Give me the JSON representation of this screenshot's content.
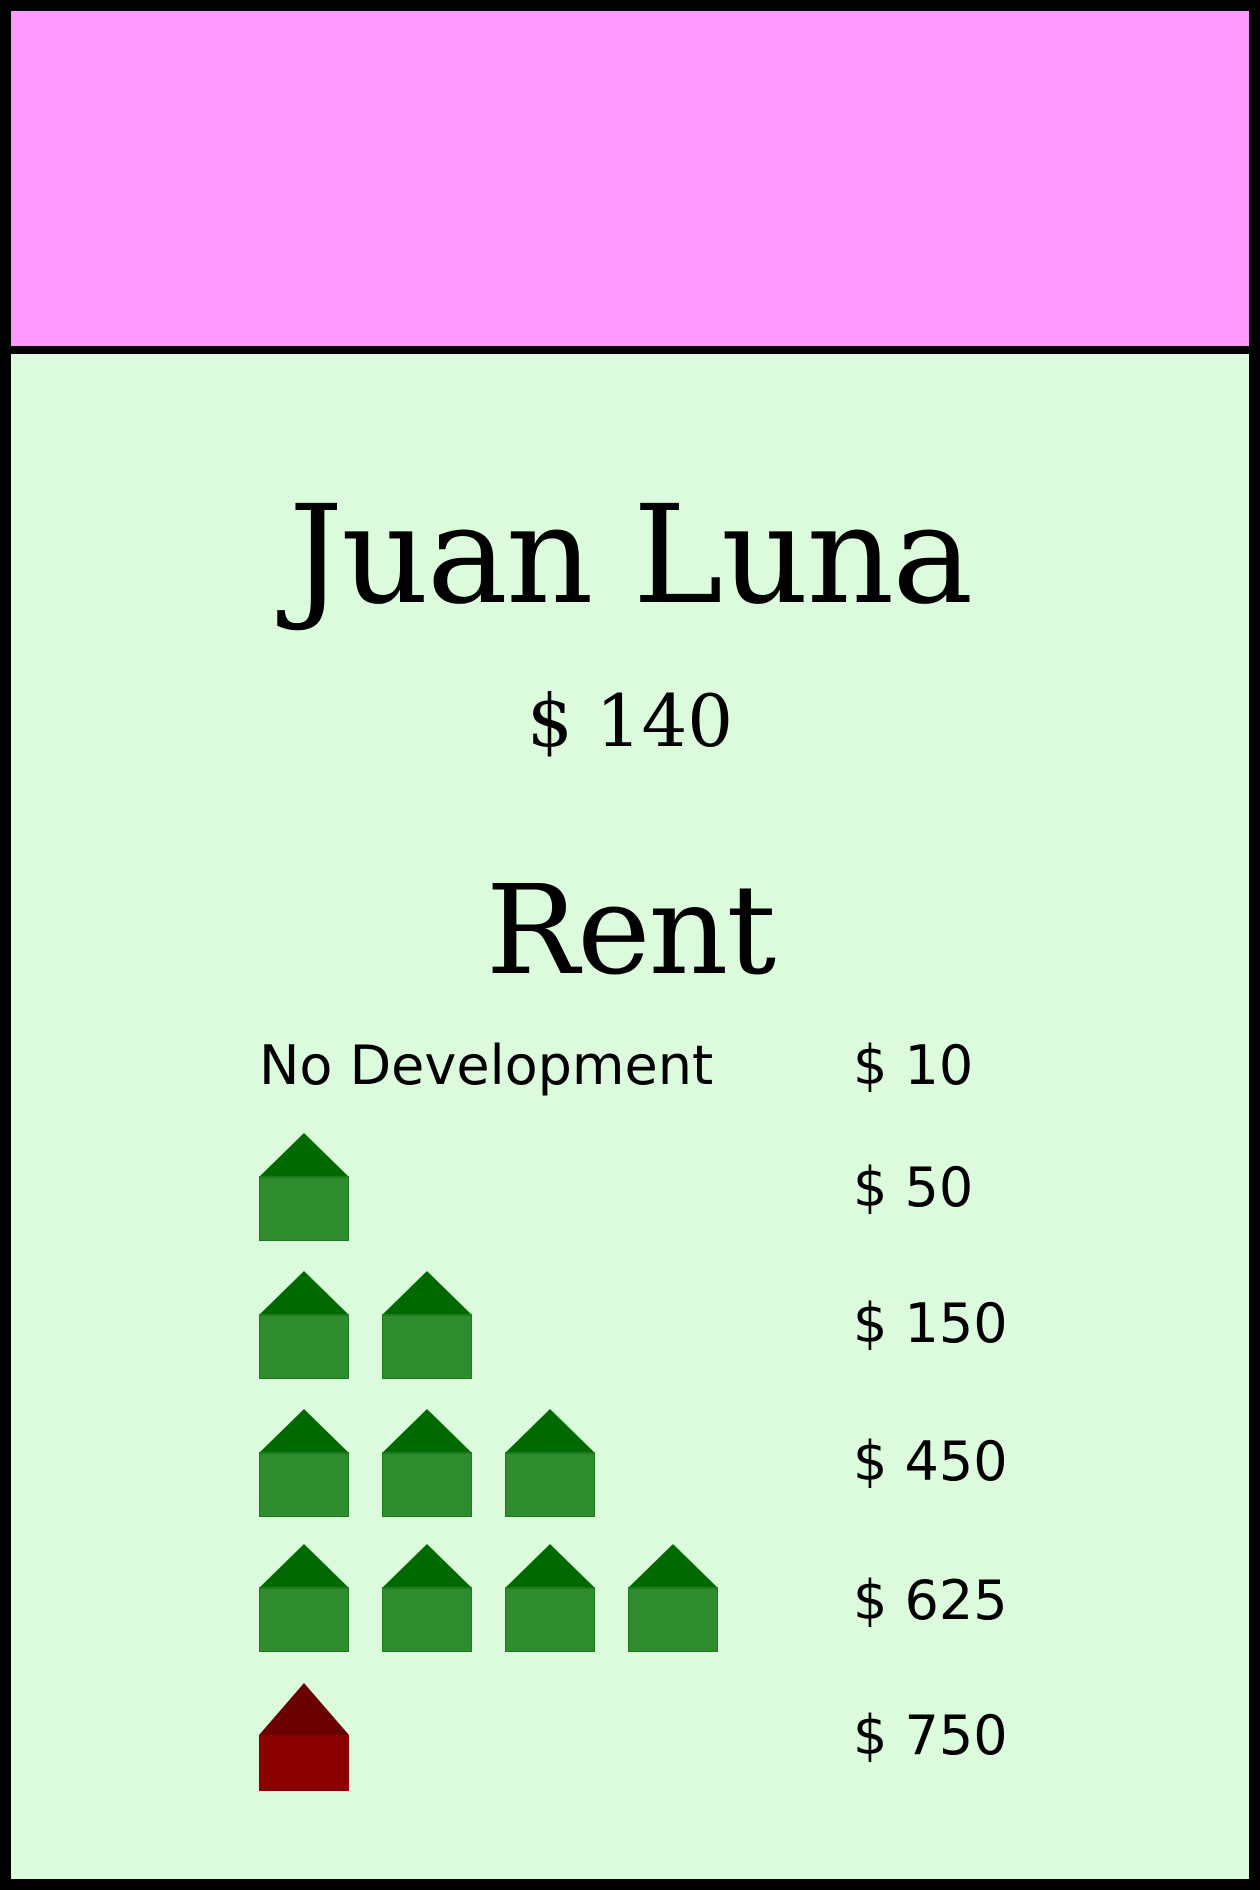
{
  "card": {
    "title": "Juan Luna",
    "price": "$ 140",
    "band_color": "#ff99ff",
    "background_color": "#dcfadc"
  },
  "rent": {
    "heading": "Rent",
    "rows": [
      {
        "label": "No Development",
        "houses": 0,
        "hotel": false,
        "value": "$ 10"
      },
      {
        "label": "",
        "houses": 1,
        "hotel": false,
        "value": "$ 50"
      },
      {
        "label": "",
        "houses": 2,
        "hotel": false,
        "value": "$ 150"
      },
      {
        "label": "",
        "houses": 3,
        "hotel": false,
        "value": "$ 450"
      },
      {
        "label": "",
        "houses": 4,
        "hotel": false,
        "value": "$ 625"
      },
      {
        "label": "",
        "houses": 0,
        "hotel": true,
        "value": "$ 750"
      }
    ]
  },
  "icons": {
    "house": {
      "name": "house-icon",
      "roof_color": "#006a00",
      "body_color": "#2e8b2e"
    },
    "hotel": {
      "name": "hotel-icon",
      "roof_color": "#6a0000",
      "body_color": "#8b0000"
    }
  }
}
